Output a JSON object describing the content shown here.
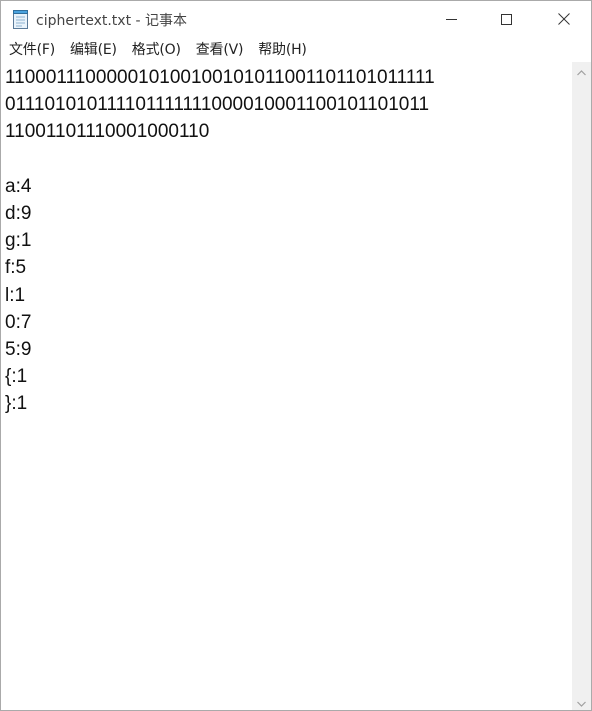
{
  "window": {
    "title": "ciphertext.txt - 记事本"
  },
  "icons": {
    "app": "notepad-icon",
    "minimize": "minimize-icon",
    "maximize": "maximize-icon",
    "close": "close-icon",
    "scroll_up": "chevron-up-icon",
    "scroll_down": "chevron-down-icon"
  },
  "menu": {
    "file": "文件(F)",
    "edit": "编辑(E)",
    "format": "格式(O)",
    "view": "查看(V)",
    "help": "帮助(H)"
  },
  "editor": {
    "content": "11000111000001010010010101100110110101111101110101011110111111100001000110010110101111001101110001000110\n\na:4\nd:9\ng:1\nf:5\nl:1\n0:7\n5:9\n{:1\n}:1"
  },
  "colors": {
    "background": "#ffffff",
    "text": "#111111",
    "title_text": "#444444",
    "scrollbar": "#f0f0f0"
  }
}
